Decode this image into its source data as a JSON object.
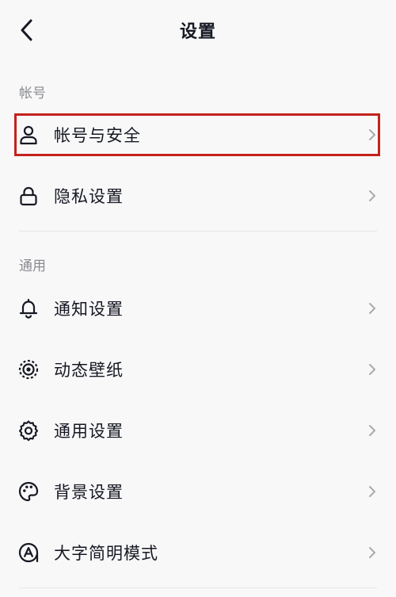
{
  "header": {
    "title": "设置",
    "back_icon": "chevron-left-icon"
  },
  "sections": [
    {
      "title": "帐号",
      "items": [
        {
          "label": "帐号与安全",
          "icon": "user-icon",
          "highlighted": true
        },
        {
          "label": "隐私设置",
          "icon": "lock-icon"
        }
      ]
    },
    {
      "title": "通用",
      "items": [
        {
          "label": "通知设置",
          "icon": "bell-icon"
        },
        {
          "label": "动态壁纸",
          "icon": "live-wallpaper-icon"
        },
        {
          "label": "通用设置",
          "icon": "gear-icon"
        },
        {
          "label": "背景设置",
          "icon": "palette-icon"
        },
        {
          "label": "大字简明模式",
          "icon": "font-size-icon"
        }
      ]
    }
  ],
  "colors": {
    "background": "#f8f8f8",
    "text": "#161823",
    "section_text": "#8a8b91",
    "chevron": "#a9aaae",
    "divider": "#e6e6e8",
    "highlight": "#c4211c"
  }
}
